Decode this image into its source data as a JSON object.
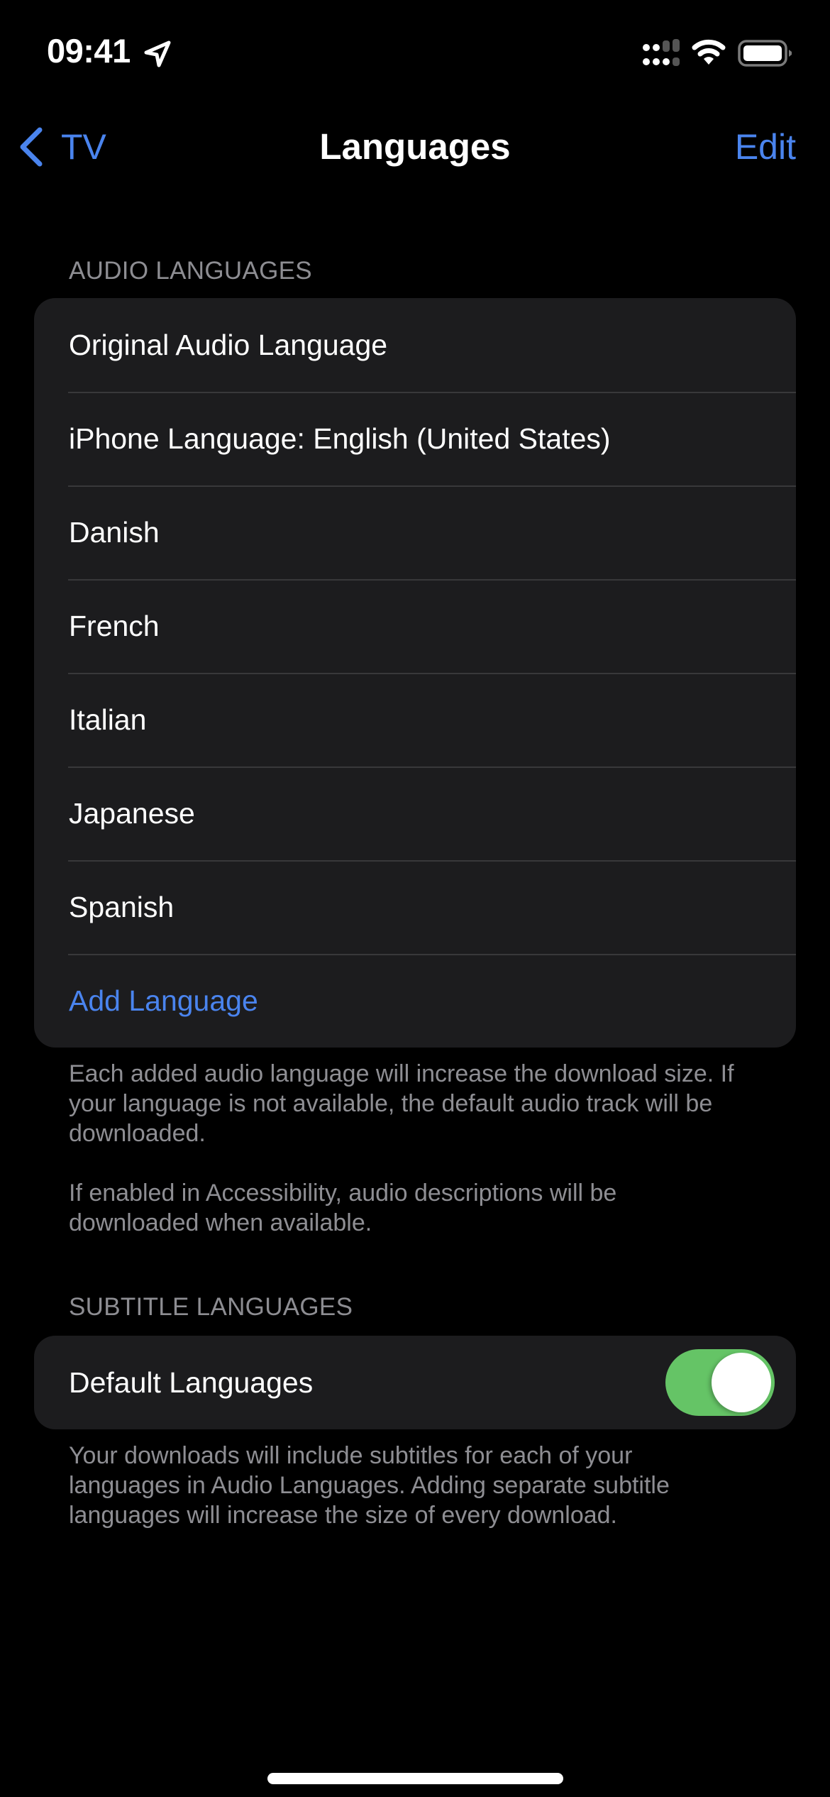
{
  "status_bar": {
    "time": "09:41",
    "icons": [
      "location-arrow-icon",
      "cellular-signal-icon",
      "wifi-icon",
      "battery-icon"
    ],
    "battery_level": 1.0
  },
  "nav": {
    "back_label": "TV",
    "title": "Languages",
    "edit_label": "Edit"
  },
  "audio_section": {
    "header": "AUDIO LANGUAGES",
    "items": [
      {
        "label": "Original Audio Language"
      },
      {
        "label": "iPhone Language: English (United States)"
      },
      {
        "label": "Danish"
      },
      {
        "label": "French"
      },
      {
        "label": "Italian"
      },
      {
        "label": "Japanese"
      },
      {
        "label": "Spanish"
      }
    ],
    "add_label": "Add Language",
    "footer": [
      "Each added audio language will increase the download size. If your language is not available, the default audio track will be downloaded.",
      "If enabled in Accessibility, audio descriptions will be downloaded when available."
    ]
  },
  "subtitle_section": {
    "header": "SUBTITLE LANGUAGES",
    "toggle_label": "Default Languages",
    "toggle_on": true,
    "footer": "Your downloads will include subtitles for each of your languages in Audio Languages. Adding separate subtitle languages will increase the size of every download."
  },
  "colors": {
    "accent": "#4a84ee",
    "toggle_on": "#65c466",
    "group_bg": "#1c1c1e",
    "secondary_text": "#8e8e93"
  }
}
